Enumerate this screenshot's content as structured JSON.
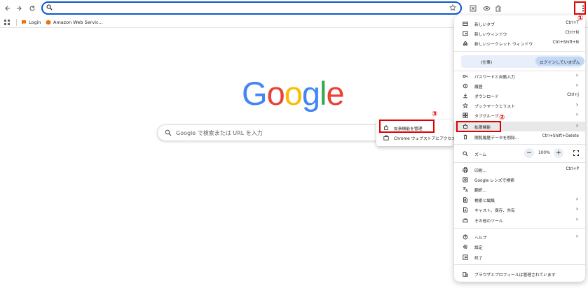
{
  "bookmarks": [
    {
      "label": "Login",
      "icon": "chat-bubble-icon",
      "color": "#e8710a"
    },
    {
      "label": "Amazon Web Servic...",
      "icon": "aws-cube-icon",
      "color": "#e8710a"
    }
  ],
  "google": {
    "logo_letters": [
      "G",
      "o",
      "o",
      "g",
      "l",
      "e"
    ],
    "logo_colors": [
      "#4285f4",
      "#ea4335",
      "#fbbc05",
      "#4285f4",
      "#34a853",
      "#ea4335"
    ],
    "search_placeholder": "Google で検索または URL を入力"
  },
  "menu": {
    "new_tab": {
      "label": "新しいタブ",
      "shortcut": "Ctrl+T"
    },
    "new_window": {
      "label": "新しいウィンドウ",
      "shortcut": "Ctrl+N"
    },
    "incognito": {
      "label": "新しいシークレット ウィンドウ",
      "shortcut": "Ctrl+Shift+N"
    },
    "profile": {
      "name": "(仕事)",
      "status": "ログインしていません"
    },
    "passwords": {
      "label": "パスワードと自動入力"
    },
    "history": {
      "label": "履歴"
    },
    "downloads": {
      "label": "ダウンロード",
      "shortcut": "Ctrl+J"
    },
    "bookmarks": {
      "label": "ブックマークとリスト"
    },
    "tab_groups": {
      "label": "タブグループ"
    },
    "extensions": {
      "label": "拡張機能"
    },
    "clear_data": {
      "label": "閲覧履歴データを削除...",
      "shortcut": "Ctrl+Shift+Delete"
    },
    "zoom": {
      "label": "ズーム",
      "minus": "−",
      "value": "100%",
      "plus": "+"
    },
    "print": {
      "label": "印刷...",
      "shortcut": "Ctrl+P"
    },
    "lens": {
      "label": "Google レンズで検索"
    },
    "translate": {
      "label": "翻訳..."
    },
    "find_edit": {
      "label": "検索と編集"
    },
    "cast_save": {
      "label": "キャスト、保存、共有"
    },
    "more_tools": {
      "label": "その他のツール"
    },
    "help": {
      "label": "ヘルプ"
    },
    "settings": {
      "label": "設定"
    },
    "exit": {
      "label": "終了"
    },
    "managed": {
      "label": "ブラウザとプロフィールは管理されています"
    }
  },
  "submenu": {
    "manage_extensions": {
      "label": "拡張機能を管理"
    },
    "web_store": {
      "label": "Chrome ウェブストアにアクセス"
    }
  },
  "annotations": {
    "step1": "①",
    "step2": "②",
    "step3": "③",
    "color": "#e00000"
  }
}
